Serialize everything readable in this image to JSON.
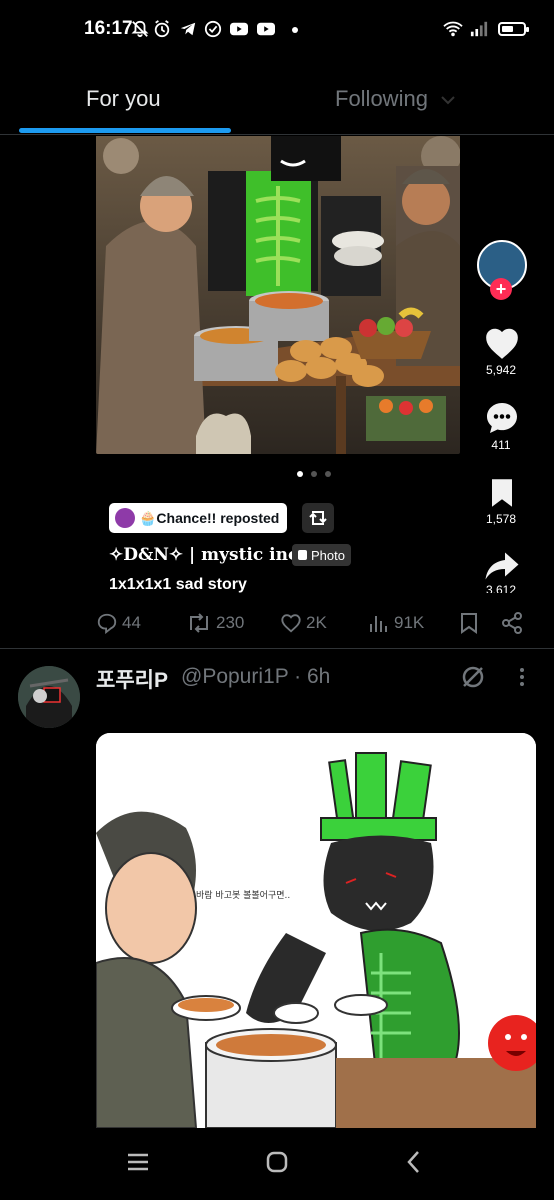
{
  "status_bar": {
    "time": "16:17"
  },
  "tabs": [
    {
      "label": "For you"
    },
    {
      "label": "Following"
    }
  ],
  "post1": {
    "reposted_by": "🧁Chance!! reposted",
    "author_line": "✧D&N✧ | mystic ino",
    "media_badge": "Photo",
    "caption": "1x1x1x1 sad story",
    "side_actions": {
      "likes": "5,942",
      "comments": "411",
      "bookmarks": "1,578",
      "shares": "3,612"
    },
    "actions": {
      "replies": "44",
      "reposts": "230",
      "likes": "2K",
      "views": "91K"
    }
  },
  "post2": {
    "display_name": "포푸리P",
    "handle_time": "@Popuri1P · 6h",
    "image_text": "바람 바고봇 볼볼어구면.."
  },
  "colors": {
    "accent": "#1d9bf0",
    "like_red": "#fe2c55",
    "muted": "#71767b"
  }
}
